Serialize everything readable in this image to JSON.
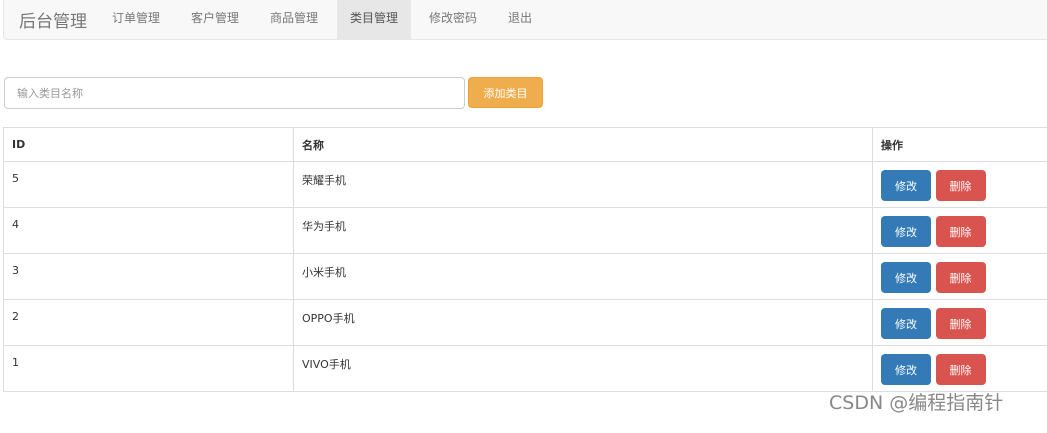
{
  "nav": {
    "brand": "后台管理",
    "items": [
      {
        "label": "订单管理"
      },
      {
        "label": "客户管理"
      },
      {
        "label": "商品管理"
      },
      {
        "label": "类目管理",
        "active": true
      },
      {
        "label": "修改密码"
      },
      {
        "label": "退出"
      }
    ]
  },
  "search": {
    "placeholder": "输入类目名称",
    "value": "",
    "button": "添加类目"
  },
  "table": {
    "headers": [
      "ID",
      "名称",
      "操作"
    ],
    "rows": [
      {
        "id": "5",
        "name": "荣耀手机"
      },
      {
        "id": "4",
        "name": "华为手机"
      },
      {
        "id": "3",
        "name": "小米手机"
      },
      {
        "id": "2",
        "name": "OPPO手机"
      },
      {
        "id": "1",
        "name": "VIVO手机"
      }
    ],
    "edit_label": "修改",
    "delete_label": "删除"
  },
  "watermark": "CSDN @编程指南针"
}
